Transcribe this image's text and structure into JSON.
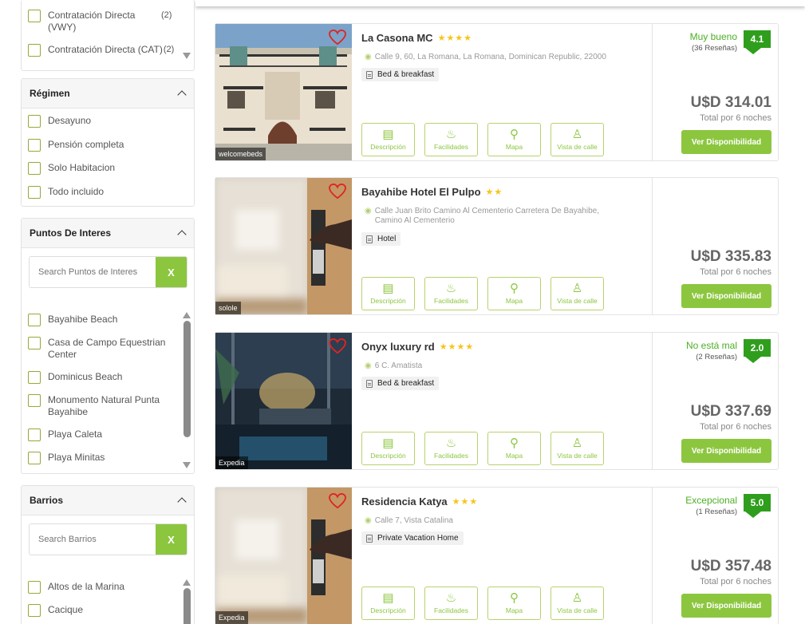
{
  "filters": {
    "contract_items": [
      {
        "label": "Contratación Directa (VWY)",
        "count": "(2)"
      },
      {
        "label": "Contratación Directa (CAT)",
        "count": "(2)"
      }
    ],
    "regimen": {
      "title": "Régimen",
      "items": [
        "Desayuno",
        "Pensión completa",
        "Solo Habitacion",
        "Todo incluido"
      ]
    },
    "puntos": {
      "title": "Puntos De Interes",
      "search_placeholder": "Search Puntos de Interes",
      "search_button": "X",
      "items": [
        "Bayahibe Beach",
        "Casa de Campo Equestrian Center",
        "Dominicus Beach",
        "Monumento Natural Punta Bayahibe",
        "Playa Caleta",
        "Playa Minitas"
      ]
    },
    "barrios": {
      "title": "Barrios",
      "search_placeholder": "Search Barrios",
      "search_button": "X",
      "items": [
        "Altos de la Marina",
        "Cacique"
      ]
    }
  },
  "actions": {
    "descripcion": "Descripción",
    "facilidades": "Facilidades",
    "mapa": "Mapa",
    "vista": "Vista de calle",
    "book": "Ver Disponibilidad"
  },
  "hotels": [
    {
      "name": "La Casona MC",
      "stars": "★★★★",
      "address": "Calle 9, 60, La Romana, La Romana, Dominican Republic, 22000",
      "type": "Bed & breakfast",
      "source": "welcomebeds",
      "rating_word": "Muy bueno",
      "rating_count": "(36 Reseñas)",
      "score": "4.1",
      "price": "U$D 314.01",
      "nights": "Total por 6 noches"
    },
    {
      "name": "Bayahibe Hotel El Pulpo",
      "stars": "★★",
      "address": "Calle Juan Brito Camino Al Cementerio Carretera De Bayahibe, Camino Al Cementerio",
      "type": "Hotel",
      "source": "solole",
      "rating_word": "",
      "rating_count": "",
      "score": "",
      "price": "U$D 335.83",
      "nights": "Total por 6 noches"
    },
    {
      "name": "Onyx luxury rd",
      "stars": "★★★★",
      "address": "6 C. Amatista",
      "type": "Bed & breakfast",
      "source": "Expedia",
      "rating_word": "No está mal",
      "rating_count": "(2 Reseñas)",
      "score": "2.0",
      "price": "U$D 337.69",
      "nights": "Total por 6 noches"
    },
    {
      "name": "Residencia Katya",
      "stars": "★★★",
      "address": "Calle 7, Vista Catalina",
      "type": "Private Vacation Home",
      "source": "Expedia",
      "rating_word": "Excepcional",
      "rating_count": "(1 Reseñas)",
      "score": "5.0",
      "price": "U$D 357.48",
      "nights": "Total por 6 noches"
    }
  ]
}
